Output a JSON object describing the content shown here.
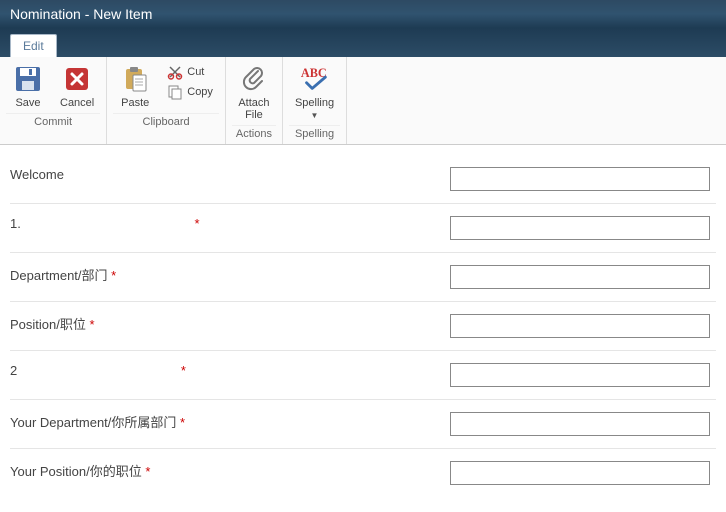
{
  "title": "Nomination - New Item",
  "tab": {
    "edit": "Edit"
  },
  "ribbon": {
    "commit": {
      "save": "Save",
      "cancel": "Cancel",
      "label": "Commit"
    },
    "clipboard": {
      "paste": "Paste",
      "cut": "Cut",
      "copy": "Copy",
      "label": "Clipboard"
    },
    "actions": {
      "attach": "Attach\nFile",
      "label": "Actions"
    },
    "spelling": {
      "spelling": "Spelling",
      "label": "Spelling"
    }
  },
  "form": {
    "fields": [
      {
        "label": "Welcome",
        "required": false
      },
      {
        "label": "1.",
        "required": true
      },
      {
        "label": "Department/部门",
        "required": true
      },
      {
        "label": "Position/职位",
        "required": true
      },
      {
        "label": "2",
        "required": true
      },
      {
        "label": "Your Department/你所属部门",
        "required": true
      },
      {
        "label": "Your Position/你的职位",
        "required": true
      }
    ],
    "required_marker": " *"
  }
}
